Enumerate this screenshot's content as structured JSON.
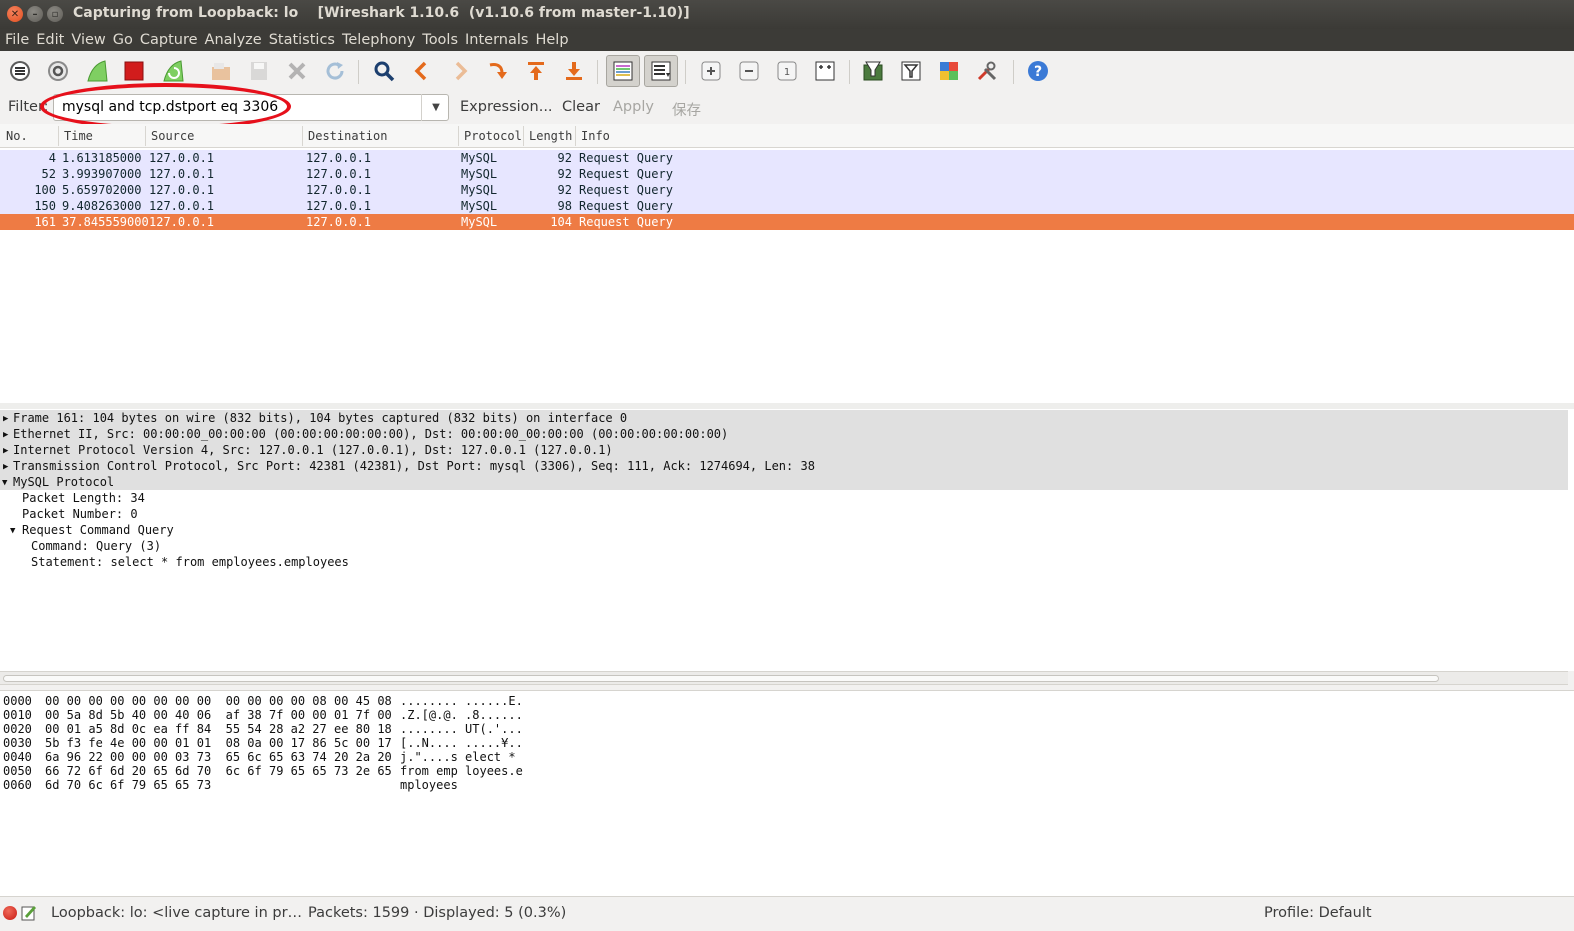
{
  "window": {
    "title": "Capturing from Loopback: lo    [Wireshark 1.10.6  (v1.10.6 from master-1.10)]"
  },
  "menu": [
    "File",
    "Edit",
    "View",
    "Go",
    "Capture",
    "Analyze",
    "Statistics",
    "Telephony",
    "Tools",
    "Internals",
    "Help"
  ],
  "toolbar": {
    "icons": [
      "list-interfaces-icon",
      "capture-options-icon",
      "start-capture-icon",
      "stop-capture-icon",
      "restart-capture-icon",
      "open-file-icon",
      "save-file-icon",
      "close-file-icon",
      "reload-icon",
      "find-packet-icon",
      "go-back-icon",
      "go-forward-icon",
      "go-to-packet-icon",
      "go-first-icon",
      "go-last-icon",
      "colorize-icon",
      "auto-scroll-icon",
      "zoom-in-icon",
      "zoom-out-icon",
      "normal-size-icon",
      "resize-columns-icon",
      "capture-filters-icon",
      "display-filters-icon",
      "coloring-rules-icon",
      "preferences-icon",
      "help-icon"
    ]
  },
  "filter": {
    "label": "Filter:",
    "value": "mysql and tcp.dstport eq 3306",
    "expression": "Expression...",
    "clear": "Clear",
    "apply": "Apply",
    "save": "保存"
  },
  "packet_list": {
    "columns": [
      "No.",
      "Time",
      "Source",
      "Destination",
      "Protocol",
      "Length",
      "Info"
    ],
    "rows": [
      {
        "no": "4",
        "time": "1.613185000",
        "source": "127.0.0.1",
        "destination": "127.0.0.1",
        "protocol": "MySQL",
        "length": "92",
        "info": "Request Query"
      },
      {
        "no": "52",
        "time": "3.993907000",
        "source": "127.0.0.1",
        "destination": "127.0.0.1",
        "protocol": "MySQL",
        "length": "92",
        "info": "Request Query"
      },
      {
        "no": "100",
        "time": "5.659702000",
        "source": "127.0.0.1",
        "destination": "127.0.0.1",
        "protocol": "MySQL",
        "length": "92",
        "info": "Request Query"
      },
      {
        "no": "150",
        "time": "9.408263000",
        "source": "127.0.0.1",
        "destination": "127.0.0.1",
        "protocol": "MySQL",
        "length": "98",
        "info": "Request Query"
      },
      {
        "no": "161",
        "time": "37.845559000",
        "source": "127.0.0.1",
        "destination": "127.0.0.1",
        "protocol": "MySQL",
        "length": "104",
        "info": "Request Query"
      }
    ],
    "selected_row": "161"
  },
  "details": [
    {
      "text": "Frame 161: 104 bytes on wire (832 bits), 104 bytes captured (832 bits) on interface 0",
      "expander": "collapsed"
    },
    {
      "text": "Ethernet II, Src: 00:00:00_00:00:00 (00:00:00:00:00:00), Dst: 00:00:00_00:00:00 (00:00:00:00:00:00)",
      "expander": "collapsed"
    },
    {
      "text": "Internet Protocol Version 4, Src: 127.0.0.1 (127.0.0.1), Dst: 127.0.0.1 (127.0.0.1)",
      "expander": "collapsed"
    },
    {
      "text": "Transmission Control Protocol, Src Port: 42381 (42381), Dst Port: mysql (3306), Seq: 111, Ack: 1274694, Len: 38",
      "expander": "collapsed"
    },
    {
      "text": "MySQL Protocol",
      "expander": "expanded"
    },
    {
      "text": "Packet Length: 34",
      "expander": "none"
    },
    {
      "text": "Packet Number: 0",
      "expander": "none"
    },
    {
      "text": "Request Command Query",
      "expander": "expanded"
    },
    {
      "text": "Command: Query (3)",
      "expander": "none"
    },
    {
      "text": "Statement: select * from employees.employees",
      "expander": "none"
    }
  ],
  "bytes": [
    {
      "offset": "0000",
      "hex": "00 00 00 00 00 00 00 00  00 00 00 00 08 00 45 08",
      "ascii": "........ ......E."
    },
    {
      "offset": "0010",
      "hex": "00 5a 8d 5b 40 00 40 06  af 38 7f 00 00 01 7f 00",
      "ascii": ".Z.[@.@. .8......"
    },
    {
      "offset": "0020",
      "hex": "00 01 a5 8d 0c ea ff 84  55 54 28 a2 27 ee 80 18",
      "ascii": "........ UT(.'..."
    },
    {
      "offset": "0030",
      "hex": "5b f3 fe 4e 00 00 01 01  08 0a 00 17 86 5c 00 17",
      "ascii": "[..N.... .....¥.."
    },
    {
      "offset": "0040",
      "hex": "6a 96 22 00 00 00 03 73  65 6c 65 63 74 20 2a 20",
      "ascii": "j.\"....s elect * "
    },
    {
      "offset": "0050",
      "hex": "66 72 6f 6d 20 65 6d 70  6c 6f 79 65 65 73 2e 65",
      "ascii": "from emp loyees.e"
    },
    {
      "offset": "0060",
      "hex": "6d 70 6c 6f 79 65 65 73",
      "ascii": "mployees"
    }
  ],
  "status": {
    "capture": "Loopback: lo: <live capture in pr…",
    "packets": "Packets: 1599 · Displayed: 5 (0.3%)",
    "profile": "Profile: Default"
  },
  "colors": {
    "row_bg": "#e7e6ff",
    "selected_bg": "#ee7b44",
    "annotation": "#e6101b"
  }
}
